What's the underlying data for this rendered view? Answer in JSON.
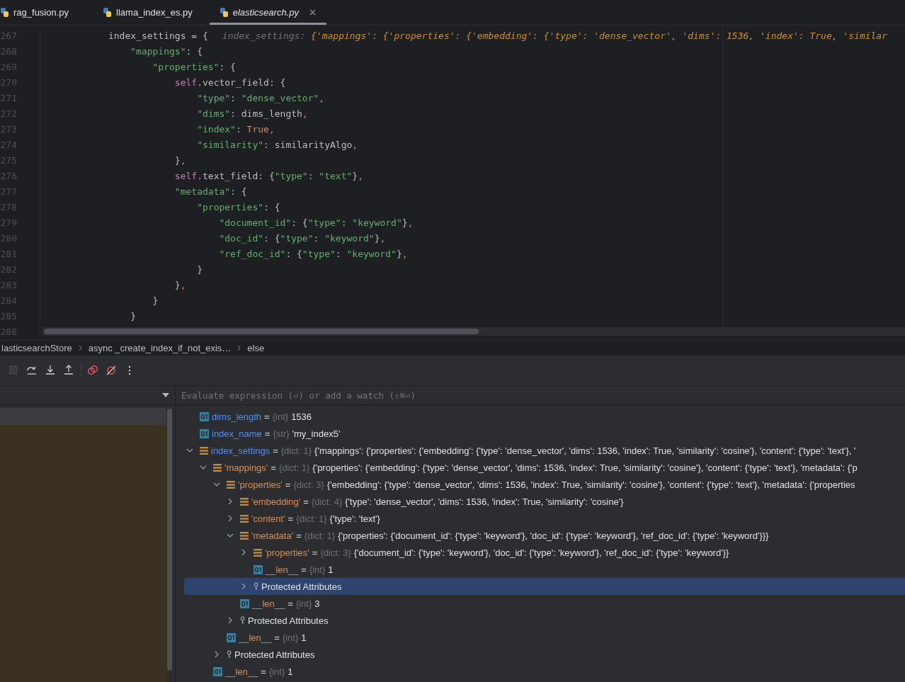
{
  "tabs": [
    {
      "label": "rag_fusion.py",
      "selected": false,
      "preview": false
    },
    {
      "label": "llama_index_es.py",
      "selected": false,
      "preview": false
    },
    {
      "label": "elasticsearch.py",
      "selected": true,
      "preview": true
    }
  ],
  "editor": {
    "lines": [
      {
        "number": "267",
        "tokens": [
          {
            "kind": "plain",
            "text": "            index_settings = {"
          },
          {
            "kind": "hint-label",
            "text": "index_settings: "
          },
          {
            "kind": "hint-value",
            "text": "{'mappings': {'properties': {'embedding': {'type': 'dense_vector', 'dims': 1536, 'index': True, 'similar"
          }
        ]
      },
      {
        "number": "268",
        "tokens": [
          {
            "kind": "string",
            "text": "                \"mappings\""
          },
          {
            "kind": "plain",
            "text": ": {"
          }
        ]
      },
      {
        "number": "269",
        "tokens": [
          {
            "kind": "string",
            "text": "                    \"properties\""
          },
          {
            "kind": "plain",
            "text": ": {"
          }
        ]
      },
      {
        "number": "270",
        "tokens": [
          {
            "kind": "self",
            "text": "                        self"
          },
          {
            "kind": "plain",
            "text": ".vector_field: {"
          }
        ]
      },
      {
        "number": "271",
        "tokens": [
          {
            "kind": "string",
            "text": "                            \"type\""
          },
          {
            "kind": "plain",
            "text": ": "
          },
          {
            "kind": "string",
            "text": "\"dense_vector\""
          },
          {
            "kind": "keyword",
            "text": ","
          }
        ]
      },
      {
        "number": "272",
        "tokens": [
          {
            "kind": "string",
            "text": "                            \"dims\""
          },
          {
            "kind": "plain",
            "text": ": dims_length"
          },
          {
            "kind": "keyword",
            "text": ","
          }
        ]
      },
      {
        "number": "273",
        "tokens": [
          {
            "kind": "string",
            "text": "                            \"index\""
          },
          {
            "kind": "plain",
            "text": ": "
          },
          {
            "kind": "keyword",
            "text": "True,"
          }
        ]
      },
      {
        "number": "274",
        "tokens": [
          {
            "kind": "string",
            "text": "                            \"similarity\""
          },
          {
            "kind": "plain",
            "text": ": similarityAlgo"
          },
          {
            "kind": "keyword",
            "text": ","
          }
        ]
      },
      {
        "number": "275",
        "tokens": [
          {
            "kind": "plain",
            "text": "                        }"
          },
          {
            "kind": "keyword",
            "text": ","
          }
        ]
      },
      {
        "number": "276",
        "tokens": [
          {
            "kind": "self",
            "text": "                        self"
          },
          {
            "kind": "plain",
            "text": ".text_field: {"
          },
          {
            "kind": "string",
            "text": "\"type\""
          },
          {
            "kind": "plain",
            "text": ": "
          },
          {
            "kind": "string",
            "text": "\"text\""
          },
          {
            "kind": "plain",
            "text": "}"
          },
          {
            "kind": "keyword",
            "text": ","
          }
        ]
      },
      {
        "number": "277",
        "tokens": [
          {
            "kind": "string",
            "text": "                        \"metadata\""
          },
          {
            "kind": "plain",
            "text": ": {"
          }
        ]
      },
      {
        "number": "278",
        "tokens": [
          {
            "kind": "string",
            "text": "                            \"properties\""
          },
          {
            "kind": "plain",
            "text": ": {"
          }
        ]
      },
      {
        "number": "279",
        "tokens": [
          {
            "kind": "string",
            "text": "                                \"document_id\""
          },
          {
            "kind": "plain",
            "text": ": {"
          },
          {
            "kind": "string",
            "text": "\"type\""
          },
          {
            "kind": "plain",
            "text": ": "
          },
          {
            "kind": "string",
            "text": "\"keyword\""
          },
          {
            "kind": "plain",
            "text": "}"
          },
          {
            "kind": "keyword",
            "text": ","
          }
        ]
      },
      {
        "number": "280",
        "tokens": [
          {
            "kind": "string",
            "text": "                                \"doc_id\""
          },
          {
            "kind": "plain",
            "text": ": {"
          },
          {
            "kind": "string",
            "text": "\"type\""
          },
          {
            "kind": "plain",
            "text": ": "
          },
          {
            "kind": "string",
            "text": "\"keyword\""
          },
          {
            "kind": "plain",
            "text": "}"
          },
          {
            "kind": "keyword",
            "text": ","
          }
        ]
      },
      {
        "number": "281",
        "tokens": [
          {
            "kind": "string",
            "text": "                                \"ref_doc_id\""
          },
          {
            "kind": "plain",
            "text": ": {"
          },
          {
            "kind": "string",
            "text": "\"type\""
          },
          {
            "kind": "plain",
            "text": ": "
          },
          {
            "kind": "string",
            "text": "\"keyword\""
          },
          {
            "kind": "plain",
            "text": "}"
          },
          {
            "kind": "keyword",
            "text": ","
          }
        ]
      },
      {
        "number": "282",
        "tokens": [
          {
            "kind": "plain",
            "text": "                            }"
          }
        ]
      },
      {
        "number": "283",
        "tokens": [
          {
            "kind": "plain",
            "text": "                        }"
          },
          {
            "kind": "keyword",
            "text": ","
          }
        ]
      },
      {
        "number": "284",
        "tokens": [
          {
            "kind": "plain",
            "text": "                    }"
          }
        ]
      },
      {
        "number": "285",
        "tokens": [
          {
            "kind": "plain",
            "text": "                }"
          }
        ]
      },
      {
        "number": "286"
      }
    ]
  },
  "breadcrumbs": [
    "lasticsearchStore",
    "async _create_index_if_not_exis…",
    "else"
  ],
  "debug_toolbar": [
    {
      "kind": "pause",
      "disabled": true
    },
    {
      "kind": "step-over",
      "disabled": false
    },
    {
      "kind": "step-into",
      "disabled": false
    },
    {
      "kind": "step-out",
      "disabled": false
    },
    {
      "kind": "separator"
    },
    {
      "kind": "breakpoints",
      "disabled": false
    },
    {
      "kind": "mute",
      "disabled": false
    },
    {
      "kind": "more",
      "disabled": false
    }
  ],
  "variables": {
    "placeholder": "Evaluate expression (⏎) or add a watch (⇧⌘⏎)",
    "tree": [
      {
        "kind": "scalar",
        "local": true,
        "name": "dims_length",
        "equals": "=",
        "type": "{int}",
        "value": "1536",
        "selected": false
      },
      {
        "kind": "scalar",
        "local": true,
        "name": "index_name",
        "equals": "=",
        "type": "{str}",
        "value": "'my_index5'",
        "selected": false
      },
      {
        "kind": "dict",
        "local": true,
        "name": "index_settings",
        "equals": "=",
        "type": "{dict: 1}",
        "value": "{'mappings': {'properties': {'embedding': {'type': 'dense_vector', 'dims': 1536, 'index': True, 'similarity': 'cosine'}, 'content': {'type': 'text'}, '",
        "expanded": true,
        "selected": false,
        "children": [
          {
            "kind": "dict",
            "local": false,
            "name": "'mappings'",
            "equals": "=",
            "type": "{dict: 1}",
            "value": "{'properties': {'embedding': {'type': 'dense_vector', 'dims': 1536, 'index': True, 'similarity': 'cosine'}, 'content': {'type': 'text'}, 'metadata': {'p",
            "expanded": true,
            "selected": false,
            "children": [
              {
                "kind": "dict",
                "local": false,
                "name": "'properties'",
                "equals": "=",
                "type": "{dict: 3}",
                "value": "{'embedding': {'type': 'dense_vector', 'dims': 1536, 'index': True, 'similarity': 'cosine'}, 'content': {'type': 'text'}, 'metadata': {'properties",
                "expanded": true,
                "selected": false,
                "children": [
                  {
                    "kind": "dict",
                    "local": false,
                    "name": "'embedding'",
                    "equals": "=",
                    "type": "{dict: 4}",
                    "value": "{'type': 'dense_vector', 'dims': 1536, 'index': True, 'similarity': 'cosine'}",
                    "expanded": false,
                    "selected": false
                  },
                  {
                    "kind": "dict",
                    "local": false,
                    "name": "'content'",
                    "equals": "=",
                    "type": "{dict: 1}",
                    "value": "{'type': 'text'}",
                    "expanded": false,
                    "selected": false
                  },
                  {
                    "kind": "dict",
                    "local": false,
                    "name": "'metadata'",
                    "equals": "=",
                    "type": "{dict: 1}",
                    "value": "{'properties': {'document_id': {'type': 'keyword'}, 'doc_id': {'type': 'keyword'}, 'ref_doc_id': {'type': 'keyword'}}}",
                    "expanded": true,
                    "selected": false,
                    "children": [
                      {
                        "kind": "dict",
                        "local": false,
                        "name": "'properties'",
                        "equals": "=",
                        "type": "{dict: 3}",
                        "value": "{'document_id': {'type': 'keyword'}, 'doc_id': {'type': 'keyword'}, 'ref_doc_id': {'type': 'keyword'}}",
                        "expanded": false,
                        "selected": false
                      },
                      {
                        "kind": "scalar",
                        "local": false,
                        "name": "__len__",
                        "equals": "=",
                        "type": "{int}",
                        "value": "1",
                        "selected": false
                      },
                      {
                        "kind": "group",
                        "name": "Protected Attributes",
                        "expanded": false,
                        "selected": true
                      }
                    ]
                  },
                  {
                    "kind": "scalar",
                    "local": false,
                    "name": "__len__",
                    "equals": "=",
                    "type": "{int}",
                    "value": "3",
                    "selected": false
                  },
                  {
                    "kind": "group",
                    "name": "Protected Attributes",
                    "expanded": false,
                    "selected": false
                  }
                ]
              },
              {
                "kind": "scalar",
                "local": false,
                "name": "__len__",
                "equals": "=",
                "type": "{int}",
                "value": "1",
                "selected": false
              },
              {
                "kind": "group",
                "name": "Protected Attributes",
                "expanded": false,
                "selected": false
              }
            ]
          },
          {
            "kind": "scalar",
            "local": false,
            "name": "__len__",
            "equals": "=",
            "type": "{int}",
            "value": "1",
            "selected": false
          }
        ]
      }
    ]
  }
}
